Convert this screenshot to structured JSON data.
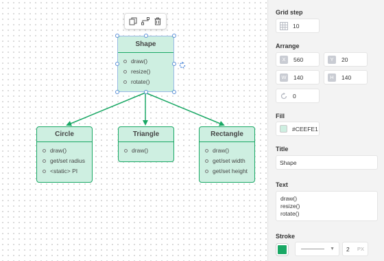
{
  "canvas": {
    "toolbar": {
      "duplicate_icon": "duplicate-icon",
      "connect_icon": "connect-icon",
      "delete_icon": "trash-icon"
    },
    "shapes": {
      "shape": {
        "title": "Shape",
        "members": [
          "draw()",
          "resize()",
          "rotate()"
        ]
      },
      "circle": {
        "title": "Circle",
        "members": [
          "draw()",
          "get/set radius",
          "<static> PI"
        ]
      },
      "triangle": {
        "title": "Triangle",
        "members": [
          "draw()"
        ]
      },
      "rectangle": {
        "title": "Rectangle",
        "members": [
          "draw()",
          "get/set width",
          "get/set height"
        ]
      }
    },
    "fill_color": "#CEEFE1",
    "stroke_color": "#1aa865",
    "selected_shape": "Shape"
  },
  "panel": {
    "grid_step": {
      "label": "Grid step",
      "value": "10"
    },
    "arrange": {
      "label": "Arrange",
      "x_icon": "X",
      "x": "560",
      "y_icon": "Y",
      "y": "20",
      "w_icon": "W",
      "w": "140",
      "h_icon": "H",
      "h": "140",
      "rotation": "0"
    },
    "fill": {
      "label": "Fill",
      "value": "#CEEFE1"
    },
    "title": {
      "label": "Title",
      "value": "Shape"
    },
    "text": {
      "label": "Text",
      "lines": [
        "draw()",
        "resize()",
        "rotate()"
      ]
    },
    "stroke": {
      "label": "Stroke",
      "color": "#1aa865",
      "width": "2",
      "unit": "PX"
    }
  }
}
